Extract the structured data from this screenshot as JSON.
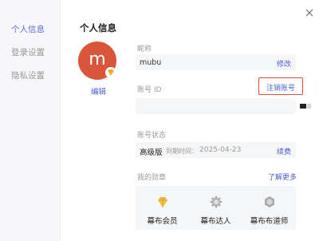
{
  "sidebar": {
    "items": [
      {
        "label": "个人信息",
        "active": true
      },
      {
        "label": "登录设置",
        "active": false
      },
      {
        "label": "隐私设置",
        "active": false
      }
    ]
  },
  "header": {
    "title": "个人信息"
  },
  "avatar": {
    "letter": "m",
    "color": "#d9563b",
    "edit_label": "编辑"
  },
  "nickname": {
    "label": "昵称",
    "value": "mubu",
    "action": "修改"
  },
  "account_id": {
    "label": "账号 ID",
    "action": "注销账号"
  },
  "account_status": {
    "label": "账号状态",
    "plan": "高级版",
    "expire_label": "到期时间：",
    "expire_date": "2025-04-23",
    "action": "续费"
  },
  "medals": {
    "label": "我的勋章",
    "action": "了解更多",
    "items": [
      {
        "name": "幕布会员",
        "icon": "diamond-medal-icon"
      },
      {
        "name": "幕布达人",
        "icon": "gear-medal-icon"
      },
      {
        "name": "幕布布道师",
        "icon": "hexagon-medal-icon"
      }
    ]
  },
  "colors": {
    "accent": "#4a5fd1",
    "highlight_border": "#e74c3c"
  }
}
